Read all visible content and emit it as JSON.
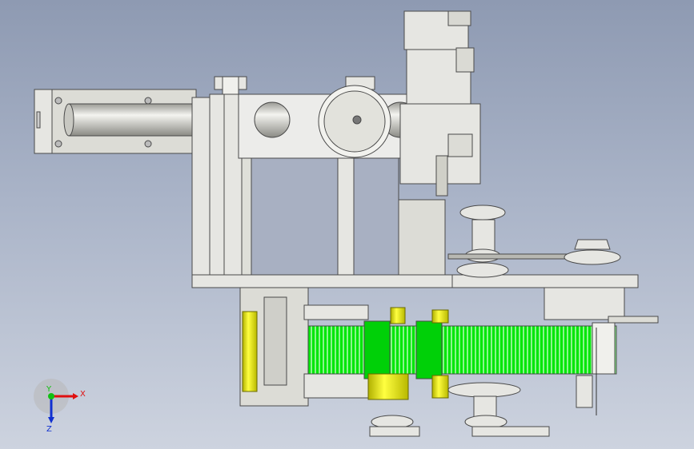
{
  "viewport": {
    "background_top": "#8e9ab2",
    "background_bottom": "#cdd3df"
  },
  "model": {
    "part_fill": "#e6e6e2",
    "part_stroke": "#4a4a4a",
    "belt_color": "#00e60a",
    "roller_color": "#f0f000"
  },
  "triad": {
    "x_label": "X",
    "y_label": "Y",
    "z_label": "Z",
    "x_color": "#e01010",
    "y_color": "#10c010",
    "z_color": "#1030d0"
  }
}
